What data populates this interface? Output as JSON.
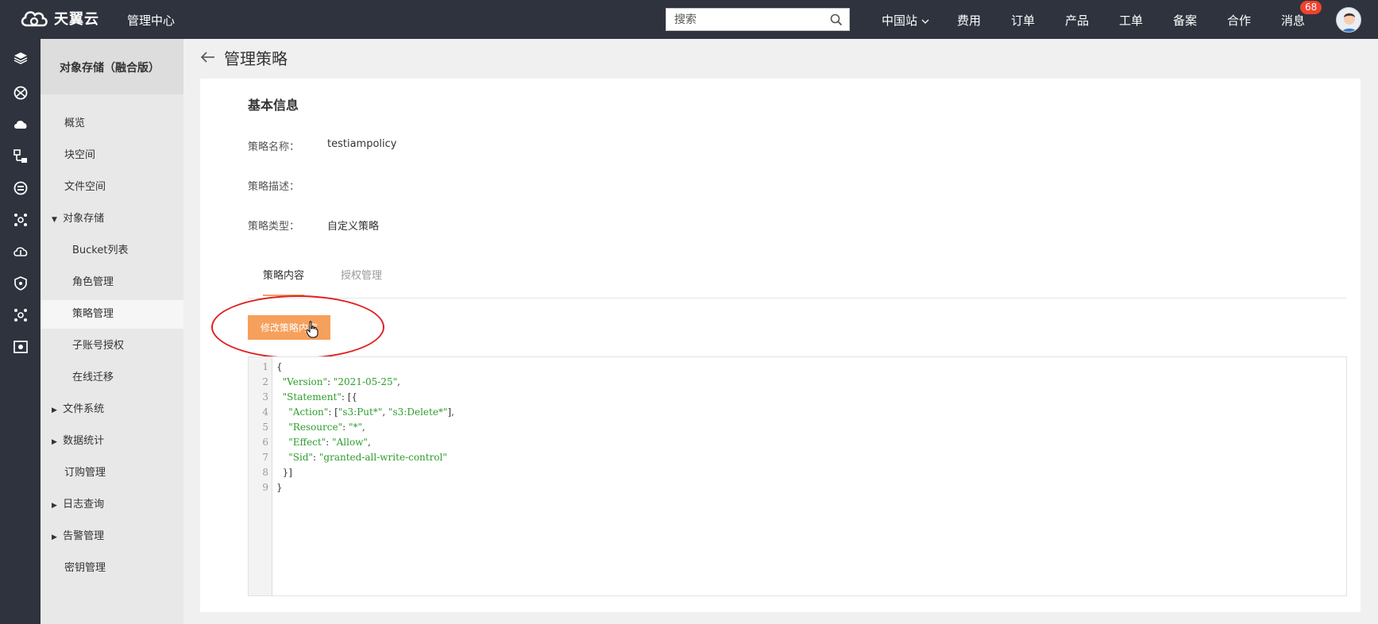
{
  "header": {
    "logo_text": "天翼云",
    "mgmt_center": "管理中心",
    "search_placeholder": "搜索",
    "region": "中国站",
    "nav": [
      "费用",
      "订单",
      "产品",
      "工单",
      "备案",
      "合作",
      "消息"
    ],
    "message_count": "68"
  },
  "rail_icons": [
    "layers-icon",
    "globe-network-icon",
    "cloud-icon",
    "topology-icon",
    "database-icon",
    "cluster-icon",
    "cloud-sync-icon",
    "shield-icon",
    "nodes-icon",
    "monitor-icon"
  ],
  "sidebar": {
    "title": "对象存储（融合版）",
    "items": [
      {
        "label": "概览",
        "level": 1
      },
      {
        "label": "块空间",
        "level": 1
      },
      {
        "label": "文件空间",
        "level": 1
      },
      {
        "label": "对象存储",
        "level": 1,
        "expander": "▼"
      },
      {
        "label": "Bucket列表",
        "level": 2
      },
      {
        "label": "角色管理",
        "level": 2
      },
      {
        "label": "策略管理",
        "level": 2,
        "active": true
      },
      {
        "label": "子账号授权",
        "level": 2
      },
      {
        "label": "在线迁移",
        "level": 2
      },
      {
        "label": "文件系统",
        "level": 1,
        "expander": "▶"
      },
      {
        "label": "数据统计",
        "level": 1,
        "expander": "▶"
      },
      {
        "label": "订购管理",
        "level": 1
      },
      {
        "label": "日志查询",
        "level": 1,
        "expander": "▶"
      },
      {
        "label": "告警管理",
        "level": 1,
        "expander": "▶"
      },
      {
        "label": "密钥管理",
        "level": 1
      }
    ]
  },
  "page": {
    "title": "管理策略",
    "section_title": "基本信息",
    "fields": [
      {
        "label": "策略名称：",
        "value": "testiampolicy"
      },
      {
        "label": "策略描述：",
        "value": ""
      },
      {
        "label": "策略类型：",
        "value": "自定义策略"
      }
    ],
    "tabs": [
      "策略内容",
      "授权管理"
    ],
    "edit_button": "修改策略内容"
  },
  "editor": {
    "line_numbers": [
      "1",
      "2",
      "3",
      "4",
      "5",
      "6",
      "7",
      "8",
      "9"
    ],
    "lines": [
      [
        {
          "t": "{",
          "c": ""
        }
      ],
      [
        {
          "t": "  ",
          "c": ""
        },
        {
          "t": "\"Version\"",
          "c": "str"
        },
        {
          "t": ": ",
          "c": ""
        },
        {
          "t": "\"2021-05-25\"",
          "c": "str"
        },
        {
          "t": ",",
          "c": ""
        }
      ],
      [
        {
          "t": "  ",
          "c": ""
        },
        {
          "t": "\"Statement\"",
          "c": "str"
        },
        {
          "t": ": [{",
          "c": ""
        }
      ],
      [
        {
          "t": "    ",
          "c": ""
        },
        {
          "t": "\"Action\"",
          "c": "str"
        },
        {
          "t": ": [",
          "c": ""
        },
        {
          "t": "\"s3:Put*\"",
          "c": "str"
        },
        {
          "t": ", ",
          "c": ""
        },
        {
          "t": "\"s3:Delete*\"",
          "c": "str"
        },
        {
          "t": "],",
          "c": ""
        }
      ],
      [
        {
          "t": "    ",
          "c": ""
        },
        {
          "t": "\"Resource\"",
          "c": "str"
        },
        {
          "t": ": ",
          "c": ""
        },
        {
          "t": "\"*\"",
          "c": "str"
        },
        {
          "t": ",",
          "c": ""
        }
      ],
      [
        {
          "t": "    ",
          "c": ""
        },
        {
          "t": "\"Effect\"",
          "c": "str"
        },
        {
          "t": ": ",
          "c": ""
        },
        {
          "t": "\"Allow\"",
          "c": "str"
        },
        {
          "t": ",",
          "c": ""
        }
      ],
      [
        {
          "t": "    ",
          "c": ""
        },
        {
          "t": "\"Sid\"",
          "c": "str"
        },
        {
          "t": ": ",
          "c": ""
        },
        {
          "t": "\"granted-all-write-control\"",
          "c": "str"
        }
      ],
      [
        {
          "t": "  }]",
          "c": ""
        }
      ],
      [
        {
          "t": "}",
          "c": ""
        }
      ]
    ]
  },
  "colors": {
    "topbar": "#2e333e",
    "accent": "#f5a05c",
    "badge": "#f0412f",
    "json_string": "#2c9c2c",
    "annotation": "#e02020"
  }
}
